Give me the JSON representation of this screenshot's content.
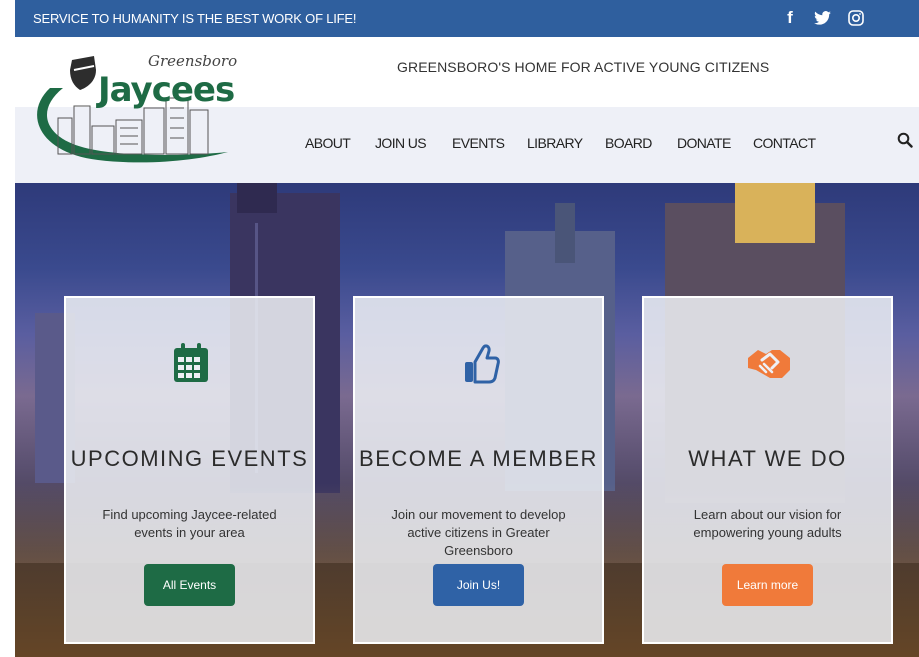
{
  "topbar": {
    "tagline": "SERVICE TO HUMANITY IS THE BEST WORK OF LIFE!",
    "social": [
      "facebook-icon",
      "twitter-icon",
      "instagram-icon"
    ]
  },
  "header": {
    "logo_script": "Greensboro",
    "logo_name": "Jaycees",
    "headline": "GREENSBORO'S HOME FOR ACTIVE YOUNG CITIZENS"
  },
  "nav": {
    "items": [
      "ABOUT",
      "JOIN US",
      "EVENTS",
      "LIBRARY",
      "BOARD",
      "DONATE",
      "CONTACT"
    ],
    "search_icon": "search-icon"
  },
  "cards": [
    {
      "icon": "calendar-icon",
      "title": "UPCOMING EVENTS",
      "desc": "Find upcoming Jaycee-related events in your area",
      "button": "All Events",
      "button_color": "#1e6b45"
    },
    {
      "icon": "thumbs-up-icon",
      "title": "BECOME A MEMBER",
      "desc": "Join our movement to develop active citizens in Greater Greensboro",
      "button": "Join Us!",
      "button_color": "#2f62a6"
    },
    {
      "icon": "handshake-icon",
      "title": "WHAT WE DO",
      "desc": "Learn about our vision for empowering young adults",
      "button": "Learn more",
      "button_color": "#f07a3a"
    }
  ],
  "colors": {
    "topbar": "#2f5f9e",
    "logo_green": "#1e6b45",
    "accent_blue": "#2f62a6",
    "accent_orange": "#f07a3a"
  }
}
